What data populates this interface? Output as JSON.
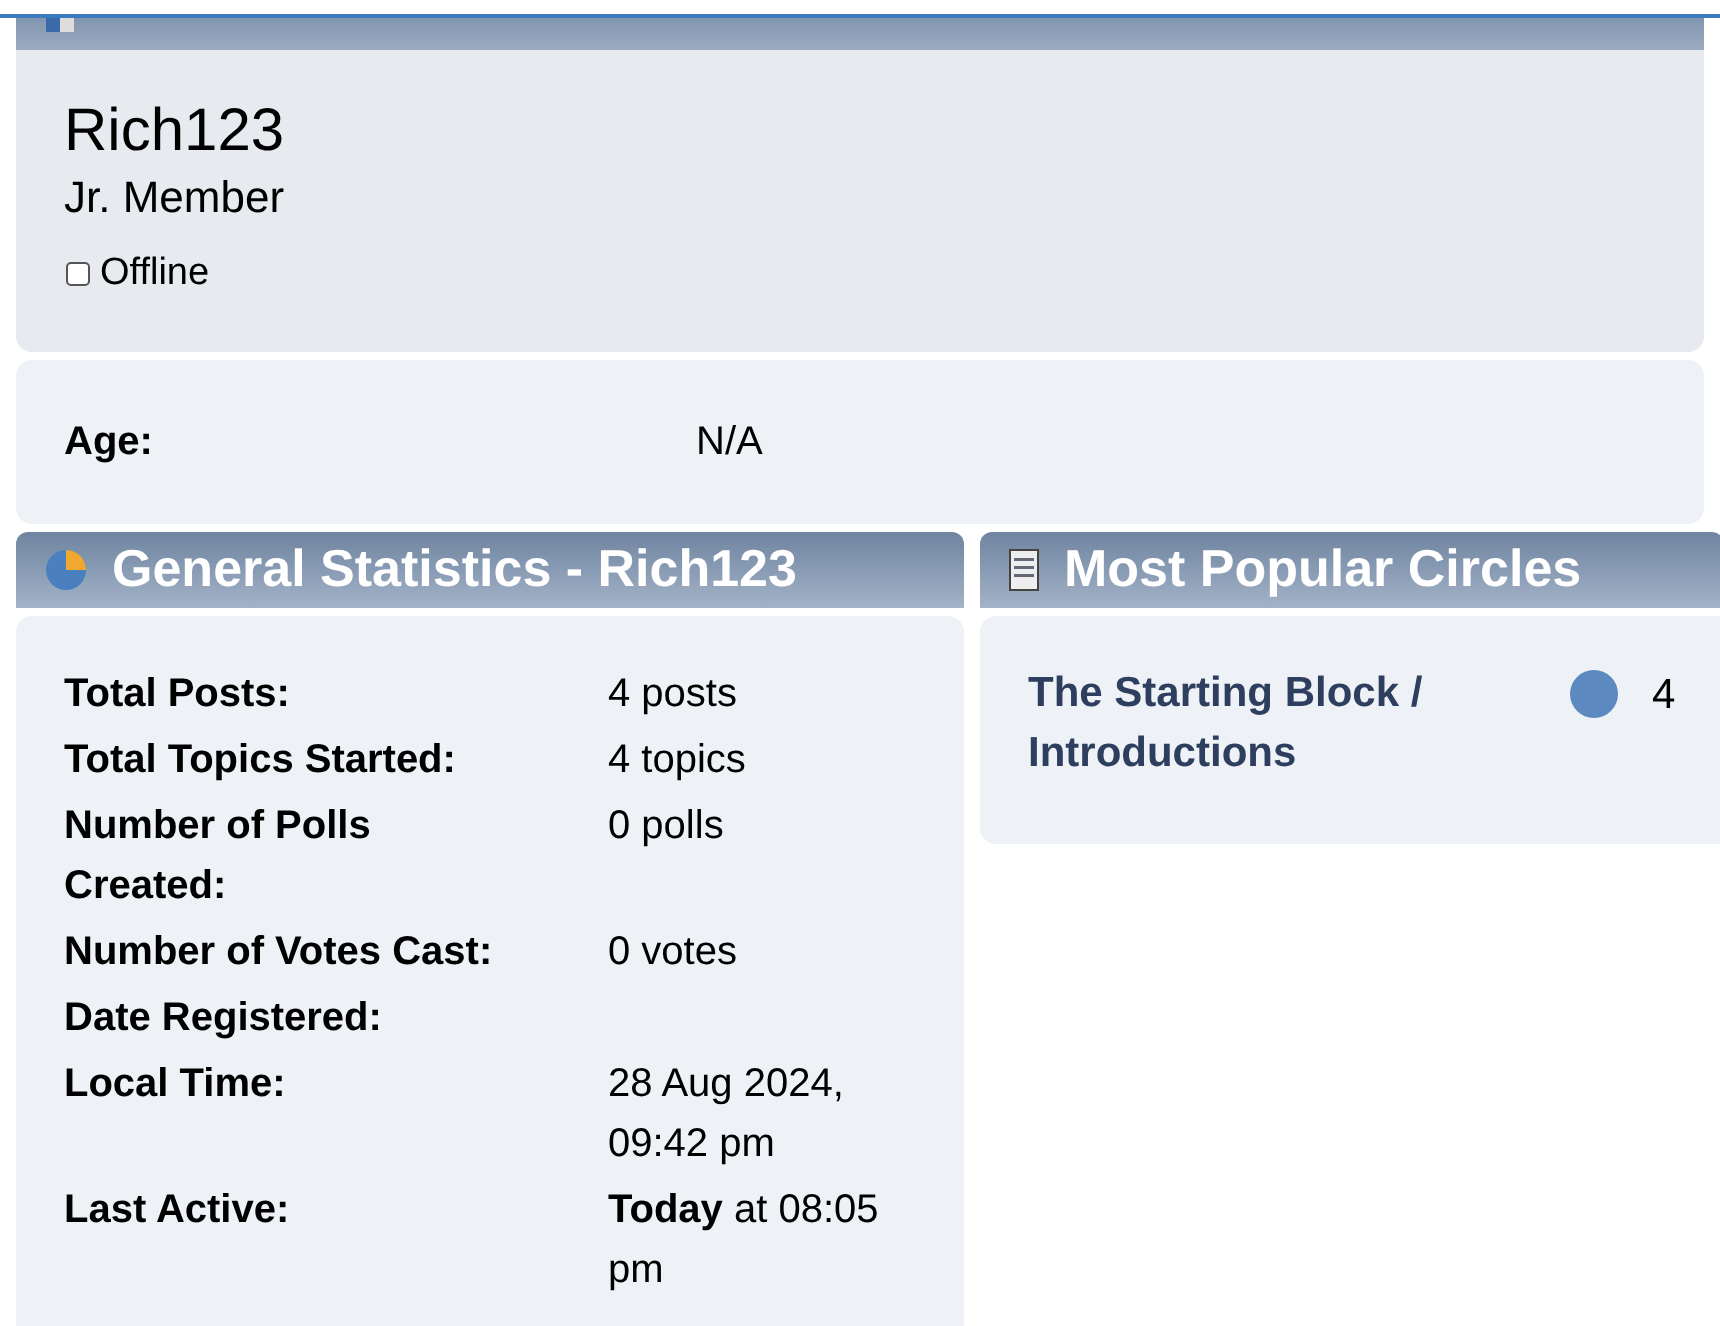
{
  "summary": {
    "username": "Rich123",
    "rank": "Jr. Member",
    "status": {
      "label": "Offline",
      "online": false
    }
  },
  "age": {
    "label": "Age:",
    "value": "N/A"
  },
  "general_statistics": {
    "title": "General Statistics - Rich123",
    "rows": [
      {
        "label": "Total Posts:",
        "value": "4 posts"
      },
      {
        "label": "Total Topics Started:",
        "value": "4 topics"
      },
      {
        "label": "Number of Polls Created:",
        "value": "0 polls"
      },
      {
        "label": "Number of Votes Cast:",
        "value": "0 votes"
      },
      {
        "label": "Date Registered:",
        "value": ""
      },
      {
        "label": "Local Time:",
        "value": "28 Aug 2024, 09:42 pm"
      },
      {
        "label": "Last Active:",
        "value": "**Today** at 08:05 pm"
      }
    ]
  },
  "popular_circles": {
    "title": "Most Popular Circles",
    "items": [
      {
        "name": "The Starting Block / Introductions",
        "count": "4"
      }
    ]
  }
}
